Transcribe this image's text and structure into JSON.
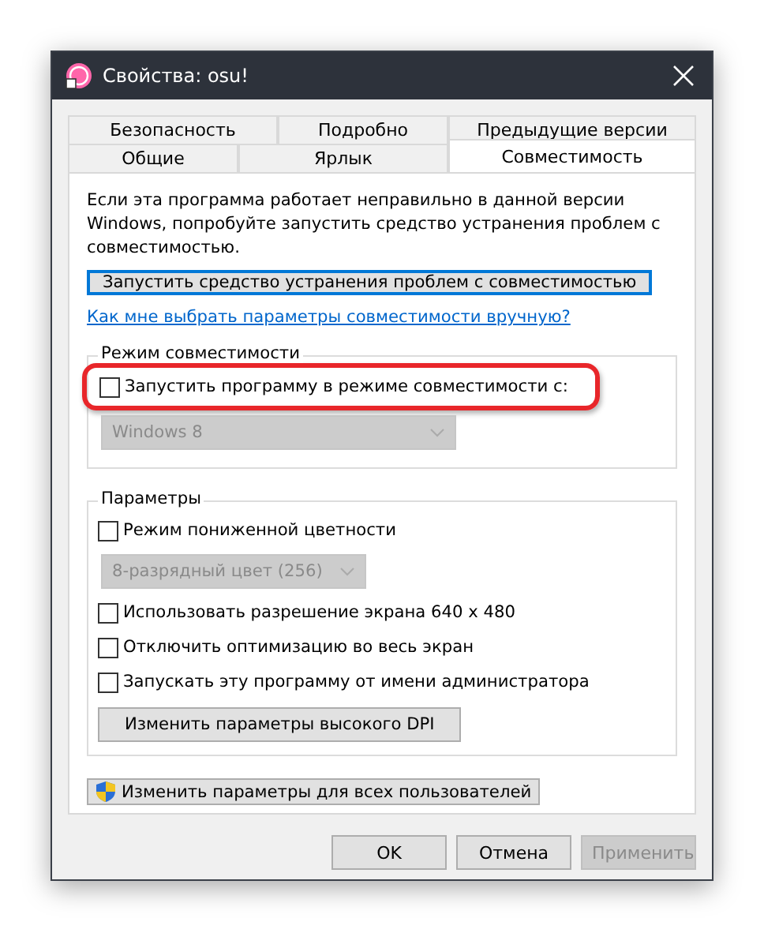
{
  "window": {
    "title": "Свойства: osu!"
  },
  "tabs": [
    [
      {
        "label": "Безопасность",
        "selected": false
      },
      {
        "label": "Подробно",
        "selected": false
      },
      {
        "label": "Предыдущие версии",
        "selected": false
      }
    ],
    [
      {
        "label": "Общие",
        "selected": false
      },
      {
        "label": "Ярлык",
        "selected": false
      },
      {
        "label": "Совместимость",
        "selected": true
      }
    ]
  ],
  "intro": "Если эта программа работает неправильно в данной версии Windows, попробуйте запустить средство устранения проблем с совместимостью.",
  "troubleshoot_button": {
    "label": "Запустить средство устранения проблем с совместимостью",
    "focused": true
  },
  "help_link": "Как мне выбрать параметры совместимости вручную?",
  "compat_mode": {
    "title": "Режим совместимости",
    "highlighted": true,
    "checkbox": {
      "label": "Запустить программу в режиме совместимости с:",
      "checked": false
    },
    "select": {
      "value": "Windows 8",
      "disabled": true
    }
  },
  "settings": {
    "title": "Параметры",
    "items": [
      {
        "kind": "checkbox",
        "label": "Режим пониженной цветности",
        "checked": false
      },
      {
        "kind": "select",
        "value": "8-разрядный цвет (256)",
        "disabled": true
      },
      {
        "kind": "checkbox",
        "label": "Использовать разрешение экрана 640 x 480",
        "checked": false
      },
      {
        "kind": "checkbox",
        "label": "Отключить оптимизацию во весь экран",
        "checked": false
      },
      {
        "kind": "checkbox",
        "label": "Запускать эту программу от имени администратора",
        "checked": false
      },
      {
        "kind": "button",
        "label": "Изменить параметры высокого DPI"
      }
    ]
  },
  "all_users_button": {
    "label": "Изменить параметры для всех пользователей"
  },
  "buttons": [
    {
      "label": "OK",
      "disabled": false
    },
    {
      "label": "Отмена",
      "disabled": false
    },
    {
      "label": "Применить",
      "disabled": true
    }
  ]
}
